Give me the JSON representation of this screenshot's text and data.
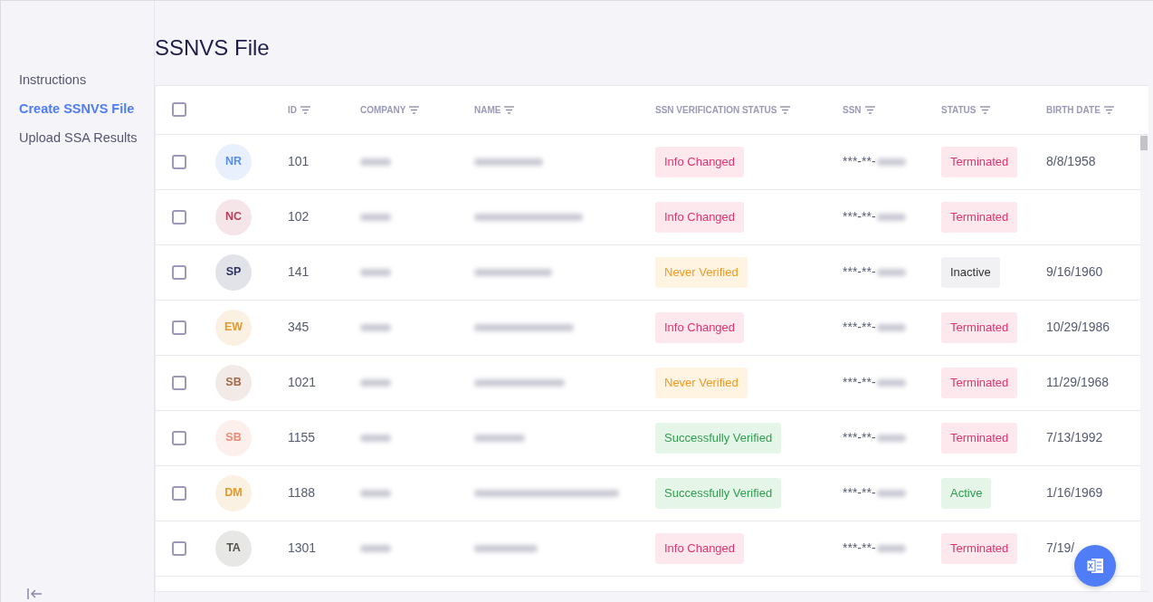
{
  "sidebar": {
    "items": [
      {
        "label": "Instructions",
        "selected": false
      },
      {
        "label": "Create SSNVS File",
        "selected": true
      },
      {
        "label": "Upload SSA Results",
        "selected": false
      }
    ]
  },
  "page": {
    "title": "SSNVS File"
  },
  "table": {
    "select_all_checked": false,
    "columns": [
      "ID",
      "COMPANY",
      "NAME",
      "SSN VERIFICATION STATUS",
      "SSN",
      "STATUS",
      "BIRTH DATE"
    ],
    "rows": [
      {
        "checked": false,
        "initials": "NR",
        "color": "#5b8def",
        "id": "101",
        "verification": {
          "label": "Info Changed",
          "kind": "danger"
        },
        "ssn": "***-**-",
        "status": {
          "label": "Terminated",
          "kind": "danger"
        },
        "birth_date": "8/8/1958"
      },
      {
        "checked": false,
        "initials": "NC",
        "color": "#b5405a",
        "id": "102",
        "verification": {
          "label": "Info Changed",
          "kind": "danger"
        },
        "ssn": "***-**-",
        "status": {
          "label": "Terminated",
          "kind": "danger"
        }
      },
      {
        "checked": false,
        "initials": "SP",
        "color": "#2d3561",
        "id": "141",
        "verification": {
          "label": "Never Verified",
          "kind": "warning"
        },
        "ssn": "***-**-",
        "status": {
          "label": "Inactive",
          "kind": "neutral"
        },
        "birth_date": "9/16/1960"
      },
      {
        "checked": false,
        "initials": "EW",
        "color": "#e39a2d",
        "id": "345",
        "verification": {
          "label": "Info Changed",
          "kind": "danger"
        },
        "ssn": "***-**-",
        "status": {
          "label": "Terminated",
          "kind": "danger"
        },
        "birth_date": "10/29/1986"
      },
      {
        "checked": false,
        "initials": "SB",
        "color": "#a26c4c",
        "id": "1021",
        "verification": {
          "label": "Never Verified",
          "kind": "warning"
        },
        "ssn": "***-**-",
        "status": {
          "label": "Terminated",
          "kind": "danger"
        },
        "birth_date": "11/29/1968"
      },
      {
        "checked": false,
        "initials": "SB",
        "color": "#ec8c74",
        "id": "1155",
        "verification": {
          "label": "Successfully Verified",
          "kind": "success"
        },
        "ssn": "***-**-",
        "status": {
          "label": "Terminated",
          "kind": "danger"
        },
        "birth_date": "7/13/1992"
      },
      {
        "checked": false,
        "initials": "DM",
        "color": "#e39a2d",
        "id": "1188",
        "verification": {
          "label": "Successfully Verified",
          "kind": "success"
        },
        "ssn": "***-**-",
        "status": {
          "label": "Active",
          "kind": "success"
        },
        "birth_date": "1/16/1969"
      },
      {
        "checked": false,
        "initials": "TA",
        "color": "#55524d",
        "id": "1301",
        "verification": {
          "label": "Info Changed",
          "kind": "danger"
        },
        "ssn": "***-**-",
        "status": {
          "label": "Terminated",
          "kind": "danger"
        },
        "birth_date": "7/19/"
      }
    ]
  }
}
